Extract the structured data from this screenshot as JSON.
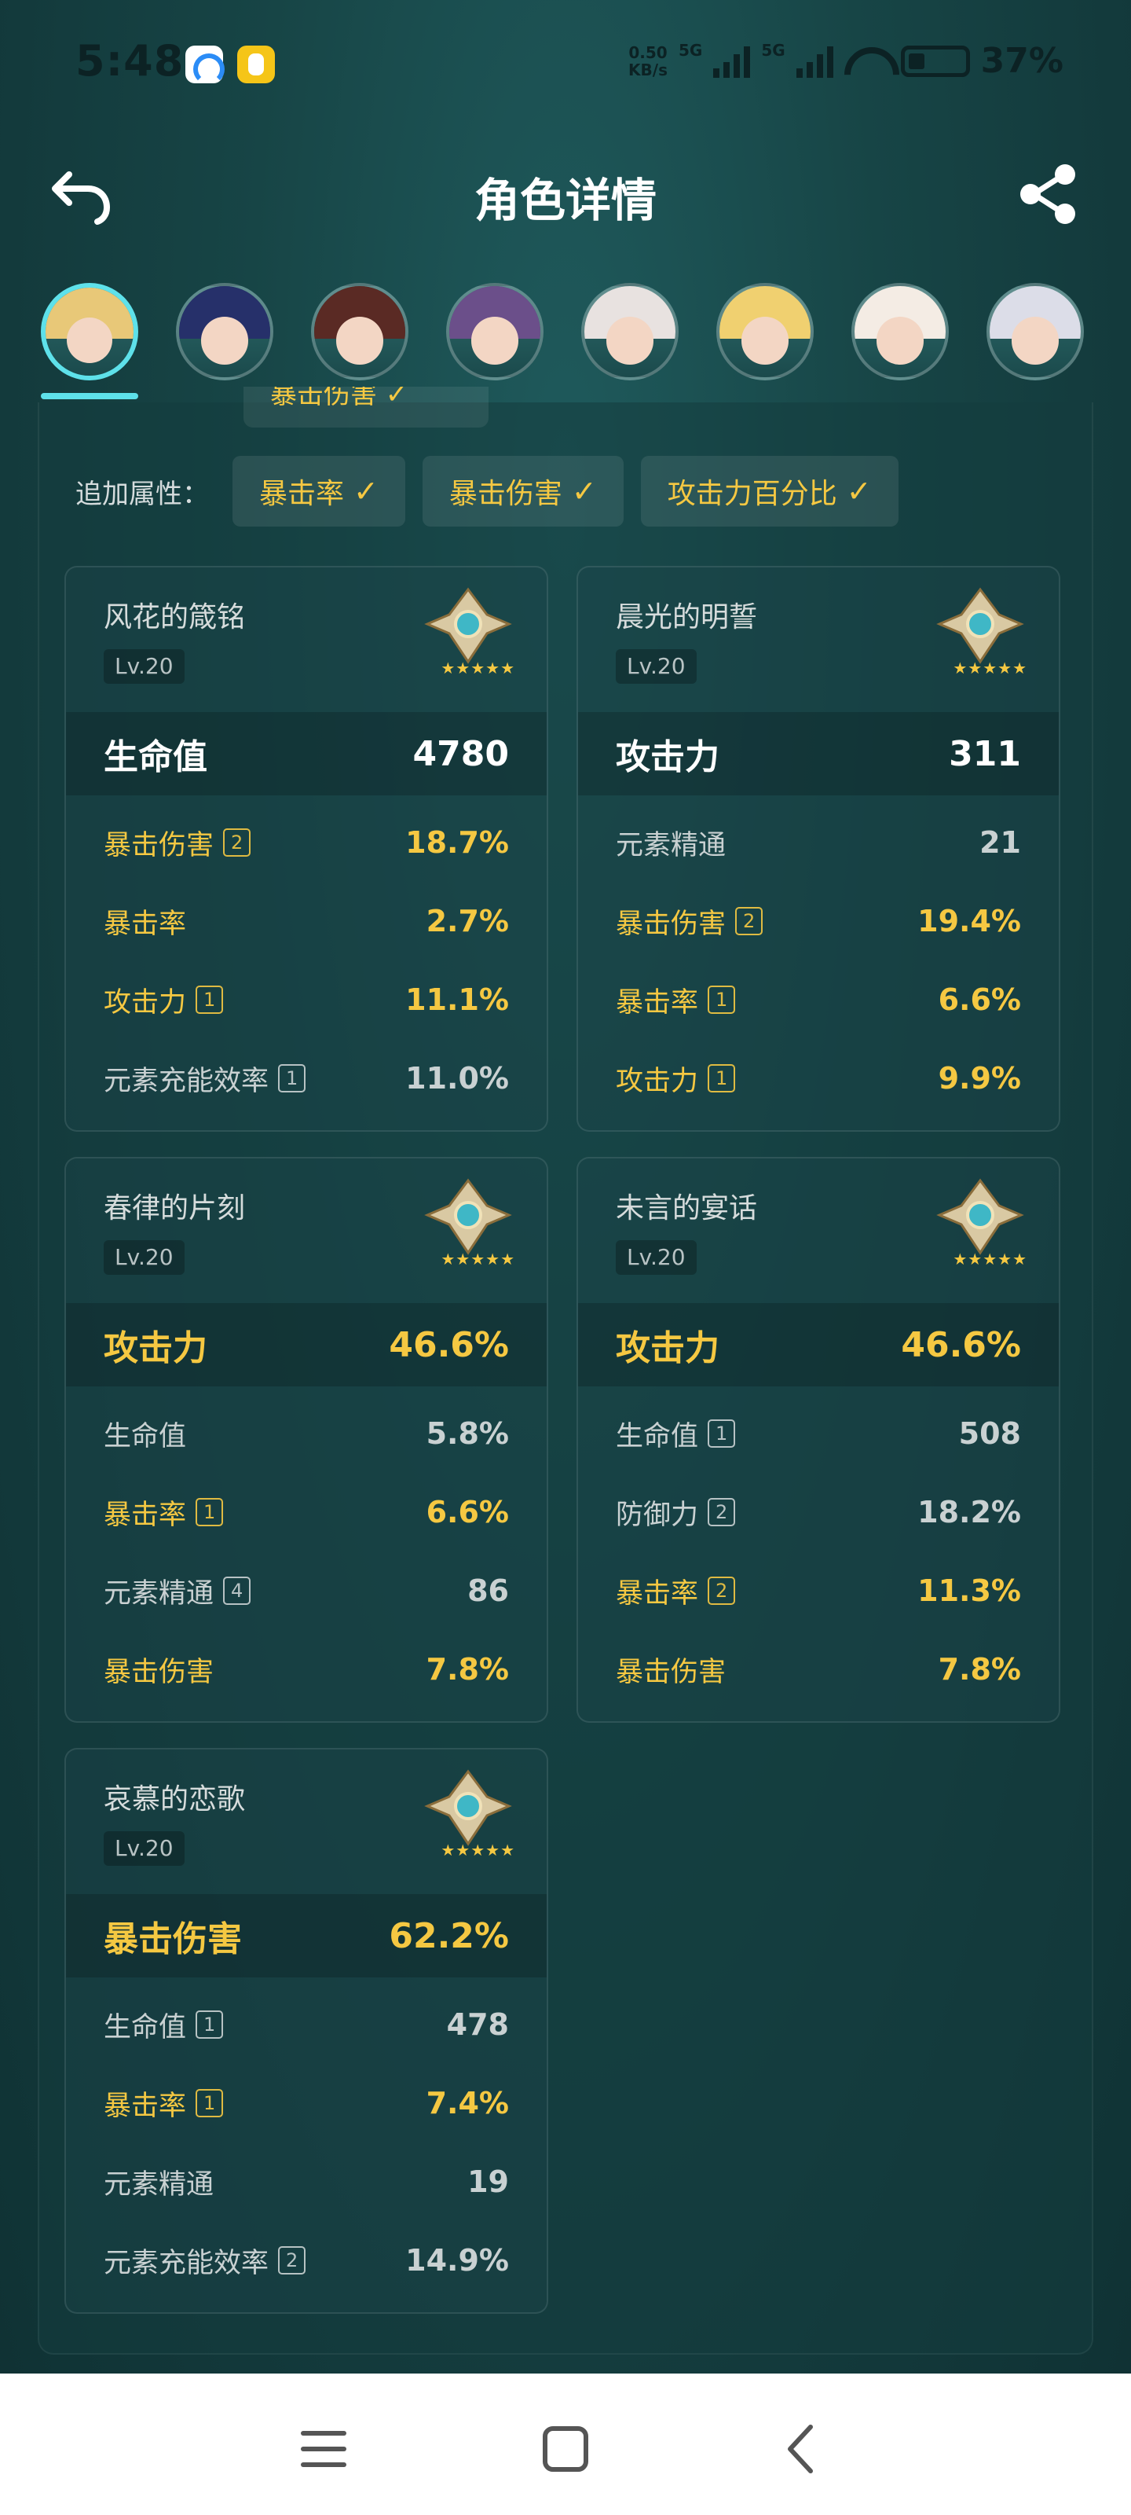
{
  "status": {
    "time": "5:48",
    "net_speed_value": "0.50",
    "net_speed_unit": "KB/s",
    "signal_label_1": "5G",
    "signal_label_2": "5G",
    "battery": "37%"
  },
  "header": {
    "title": "角色详情"
  },
  "avatars": [
    {
      "hair": "#e8c878",
      "active": true
    },
    {
      "hair": "#26306a",
      "active": false
    },
    {
      "hair": "#5a2a24",
      "active": false
    },
    {
      "hair": "#6b4f8a",
      "active": false
    },
    {
      "hair": "#e8e2e0",
      "active": false
    },
    {
      "hair": "#f0d070",
      "active": false
    },
    {
      "hair": "#f4ece4",
      "active": false
    },
    {
      "hair": "#dcdde8",
      "active": false
    }
  ],
  "extra_attrs": {
    "label": "追加属性：",
    "chips": [
      "暴击率",
      "暴击伤害",
      "攻击力百分比"
    ],
    "cut_tag": "暴击伤害 ✓"
  },
  "artifacts": [
    {
      "name": "风花的箴铭",
      "level": "Lv.20",
      "stars": "★★★★★",
      "main": {
        "label": "生命值",
        "value": "4780",
        "highlight": false
      },
      "subs": [
        {
          "label": "暴击伤害",
          "count": "2",
          "value": "18.7%",
          "highlight": true
        },
        {
          "label": "暴击率",
          "count": "",
          "value": "2.7%",
          "highlight": true
        },
        {
          "label": "攻击力",
          "count": "1",
          "value": "11.1%",
          "highlight": true
        },
        {
          "label": "元素充能效率",
          "count": "1",
          "value": "11.0%",
          "highlight": false
        }
      ]
    },
    {
      "name": "晨光的明誓",
      "level": "Lv.20",
      "stars": "★★★★★",
      "main": {
        "label": "攻击力",
        "value": "311",
        "highlight": false
      },
      "subs": [
        {
          "label": "元素精通",
          "count": "",
          "value": "21",
          "highlight": false
        },
        {
          "label": "暴击伤害",
          "count": "2",
          "value": "19.4%",
          "highlight": true
        },
        {
          "label": "暴击率",
          "count": "1",
          "value": "6.6%",
          "highlight": true
        },
        {
          "label": "攻击力",
          "count": "1",
          "value": "9.9%",
          "highlight": true
        }
      ]
    },
    {
      "name": "春律的片刻",
      "level": "Lv.20",
      "stars": "★★★★★",
      "main": {
        "label": "攻击力",
        "value": "46.6%",
        "highlight": true
      },
      "subs": [
        {
          "label": "生命值",
          "count": "",
          "value": "5.8%",
          "highlight": false
        },
        {
          "label": "暴击率",
          "count": "1",
          "value": "6.6%",
          "highlight": true
        },
        {
          "label": "元素精通",
          "count": "4",
          "value": "86",
          "highlight": false
        },
        {
          "label": "暴击伤害",
          "count": "",
          "value": "7.8%",
          "highlight": true
        }
      ]
    },
    {
      "name": "未言的宴话",
      "level": "Lv.20",
      "stars": "★★★★★",
      "main": {
        "label": "攻击力",
        "value": "46.6%",
        "highlight": true
      },
      "subs": [
        {
          "label": "生命值",
          "count": "1",
          "value": "508",
          "highlight": false
        },
        {
          "label": "防御力",
          "count": "2",
          "value": "18.2%",
          "highlight": false
        },
        {
          "label": "暴击率",
          "count": "2",
          "value": "11.3%",
          "highlight": true
        },
        {
          "label": "暴击伤害",
          "count": "",
          "value": "7.8%",
          "highlight": true
        }
      ]
    },
    {
      "name": "哀慕的恋歌",
      "level": "Lv.20",
      "stars": "★★★★★",
      "main": {
        "label": "暴击伤害",
        "value": "62.2%",
        "highlight": true
      },
      "subs": [
        {
          "label": "生命值",
          "count": "1",
          "value": "478",
          "highlight": false
        },
        {
          "label": "暴击率",
          "count": "1",
          "value": "7.4%",
          "highlight": true
        },
        {
          "label": "元素精通",
          "count": "",
          "value": "19",
          "highlight": false
        },
        {
          "label": "元素充能效率",
          "count": "2",
          "value": "14.9%",
          "highlight": false
        }
      ]
    }
  ],
  "colors": {
    "gold": "#f5c842",
    "accent": "#5ee1ea",
    "bg": "#174546"
  }
}
